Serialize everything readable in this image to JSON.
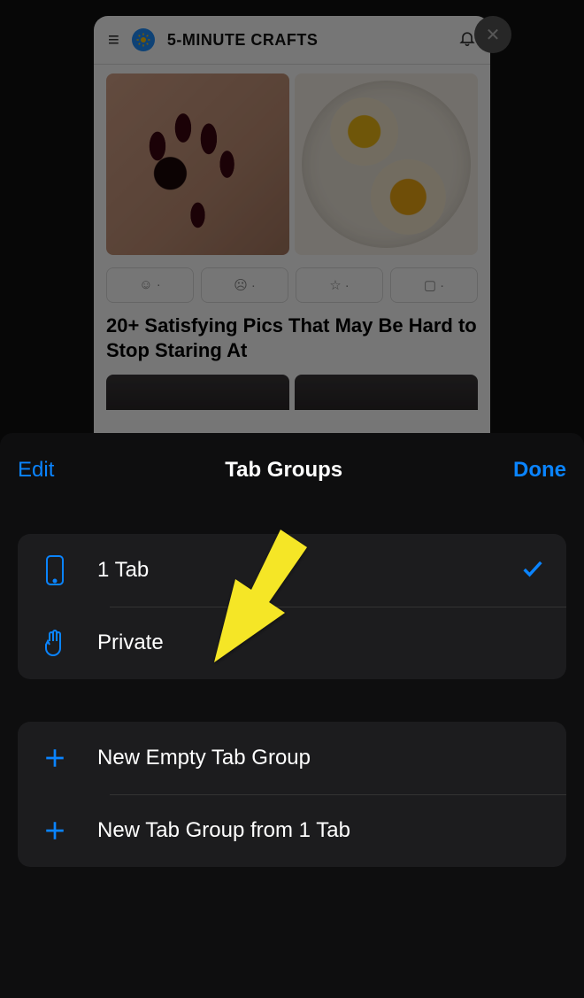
{
  "tab_card": {
    "hamburger": "≡",
    "brand": "5-MINUTE CRAFTS",
    "reactions": {
      "smile": "☺ ·",
      "sad": "☹ ·",
      "star": "☆ ·",
      "comment": "▢ ·"
    },
    "article_title": "20+ Satisfying Pics That May Be Hard to Stop Staring At"
  },
  "sheet": {
    "edit": "Edit",
    "title": "Tab Groups",
    "done": "Done",
    "rows": {
      "tabs": "1 Tab",
      "private": "Private",
      "new_empty": "New Empty Tab Group",
      "new_from": "New Tab Group from 1 Tab"
    }
  },
  "colors": {
    "accent": "#0a84ff",
    "arrow": "#f5e625"
  }
}
